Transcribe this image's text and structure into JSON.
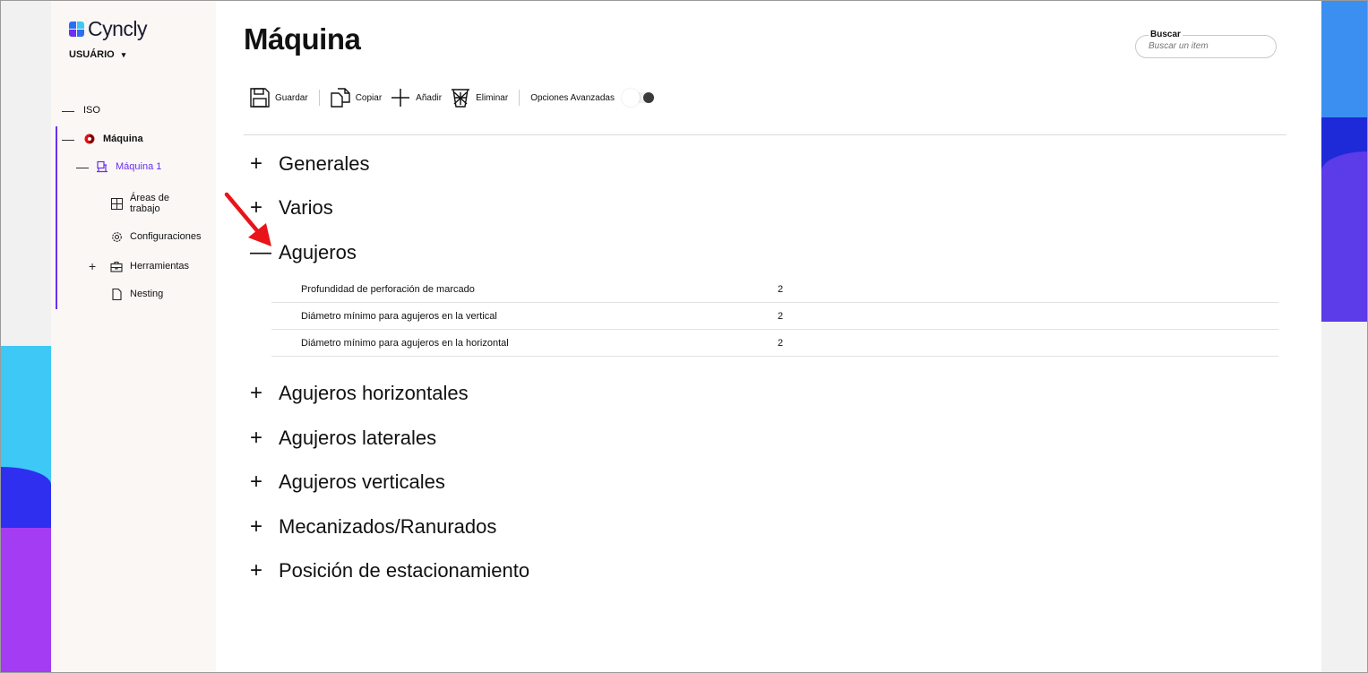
{
  "app": {
    "logo_text": "Cyncly",
    "user_label": "USUÁRIO",
    "user_chevron": "▾"
  },
  "sidebar": {
    "items": [
      {
        "label": "ISO",
        "toggle": "—"
      },
      {
        "label": "Máquina",
        "toggle": "—"
      },
      {
        "label": "Máquina 1",
        "toggle": "—"
      },
      {
        "label_line1": "Áreas de",
        "label_line2": "trabajo"
      },
      {
        "label": "Configuraciones"
      },
      {
        "label": "Herramientas",
        "toggle": "+"
      },
      {
        "label": "Nesting"
      }
    ]
  },
  "header": {
    "title": "Máquina"
  },
  "search": {
    "label": "Buscar",
    "placeholder": "Buscar un item"
  },
  "toolbar": {
    "save_label": "Guardar",
    "copy_label": "Copiar",
    "add_label": "Añadir",
    "delete_label": "Eliminar",
    "advanced_label": "Opciones Avanzadas"
  },
  "sections": [
    {
      "title": "Generales",
      "sign": "+"
    },
    {
      "title": "Varios",
      "sign": "+"
    },
    {
      "title": "Agujeros",
      "sign": "—"
    },
    {
      "title": "Agujeros horizontales",
      "sign": "+"
    },
    {
      "title": "Agujeros laterales",
      "sign": "+"
    },
    {
      "title": "Agujeros verticales",
      "sign": "+"
    },
    {
      "title": "Mecanizados/Ranurados",
      "sign": "+"
    },
    {
      "title": "Posición de estacionamiento",
      "sign": "+"
    }
  ],
  "agujeros_rows": [
    {
      "label": "Profundidad de perforación de marcado",
      "value": "2"
    },
    {
      "label": "Diámetro mínimo para agujeros en la vertical",
      "value": "2"
    },
    {
      "label": "Diámetro mínimo para agujeros en la horizontal",
      "value": "2"
    }
  ],
  "colors": {
    "accent": "#6a2ff0",
    "arrow": "#e8141a"
  }
}
